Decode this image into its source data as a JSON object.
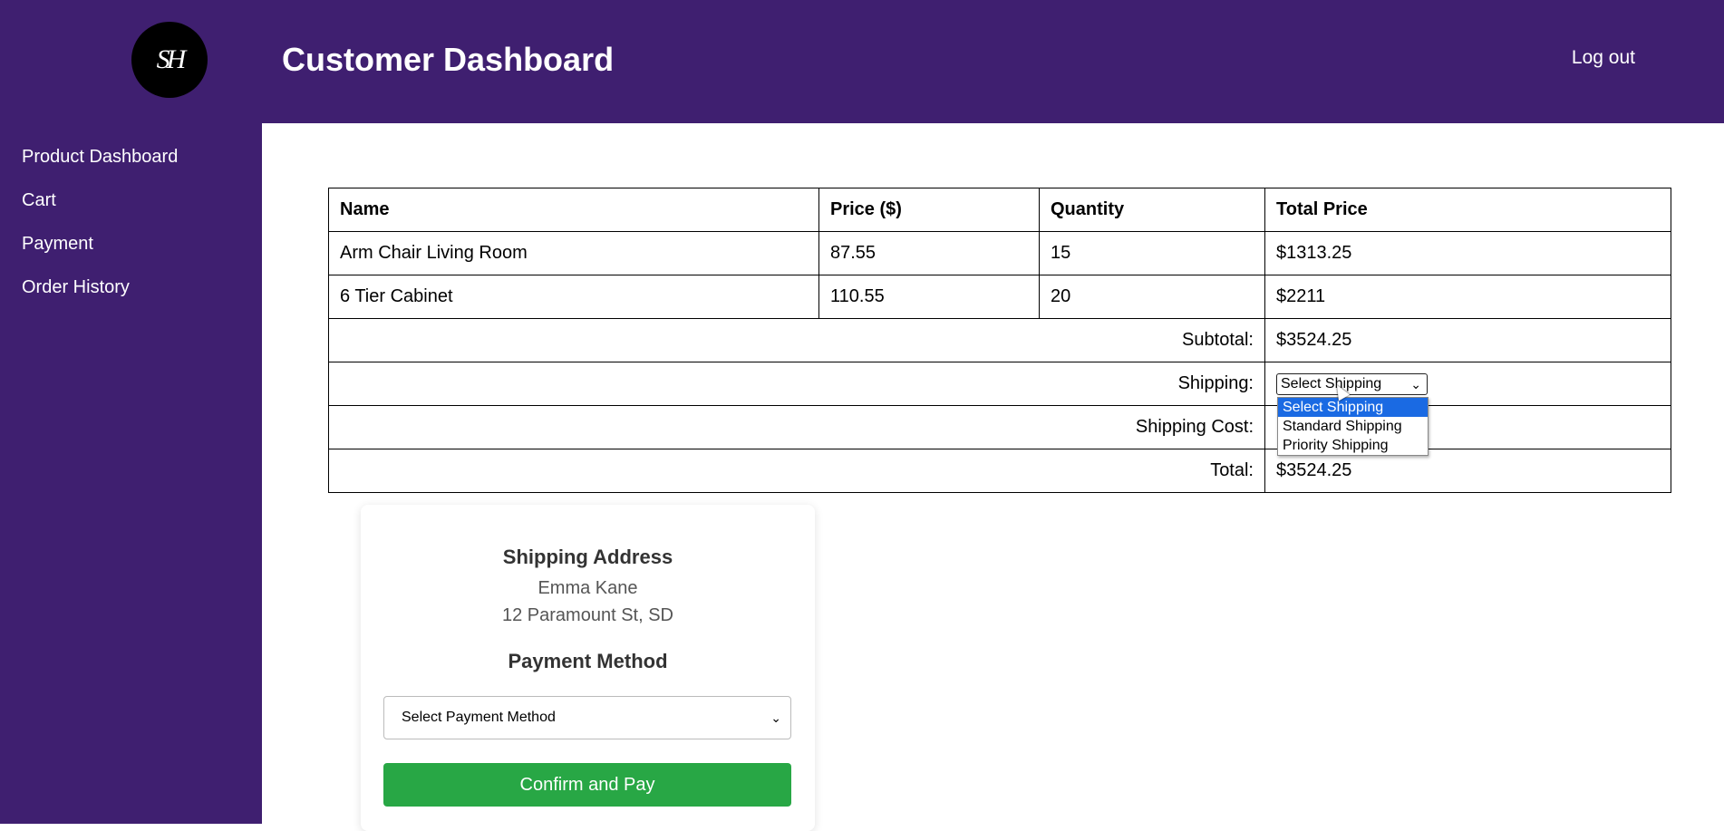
{
  "header": {
    "logo_text": "SH",
    "title": "Customer Dashboard",
    "logout_label": "Log out"
  },
  "sidebar": {
    "items": [
      {
        "label": "Product Dashboard"
      },
      {
        "label": "Cart"
      },
      {
        "label": "Payment"
      },
      {
        "label": "Order History"
      }
    ]
  },
  "cart": {
    "columns": [
      "Name",
      "Price ($)",
      "Quantity",
      "Total Price"
    ],
    "rows": [
      {
        "name": "Arm Chair Living Room",
        "price": "87.55",
        "quantity": "15",
        "total": "$1313.25"
      },
      {
        "name": "6 Tier Cabinet",
        "price": "110.55",
        "quantity": "20",
        "total": "$2211"
      }
    ],
    "subtotal_label": "Subtotal:",
    "subtotal_value": "$3524.25",
    "shipping_label": "Shipping:",
    "shipping_selected": "Select Shipping",
    "shipping_options": [
      "Select Shipping",
      "Standard Shipping",
      "Priority Shipping"
    ],
    "shipping_cost_label": "Shipping Cost:",
    "total_label": "Total:",
    "total_value": "$3524.25"
  },
  "checkout": {
    "shipping_address_heading": "Shipping Address",
    "address_name": "Emma Kane",
    "address_line": "12 Paramount St, SD",
    "payment_method_heading": "Payment Method",
    "payment_select_value": "Select Payment Method",
    "confirm_label": "Confirm and Pay"
  },
  "colors": {
    "brand_purple": "#3f1f70",
    "confirm_green": "#28a745",
    "dropdown_highlight": "#1a6ae3"
  }
}
